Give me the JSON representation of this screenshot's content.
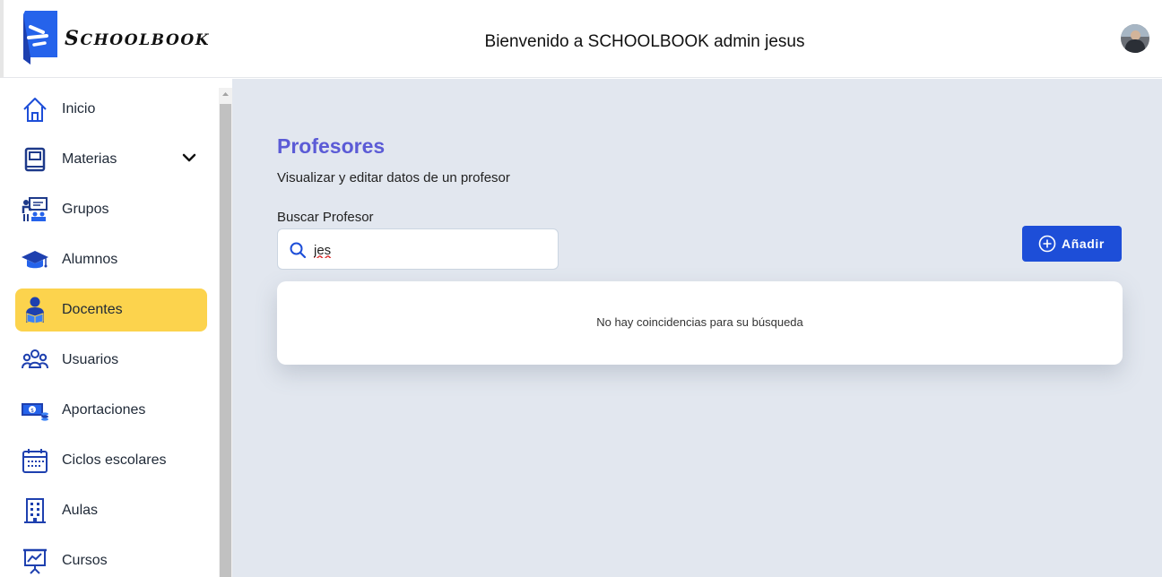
{
  "header": {
    "logo_text_first": "S",
    "logo_text_rest": "CHOOLBOOK",
    "welcome": "Bienvenido a SCHOOLBOOK admin jesus",
    "colors": {
      "logo_blue": "#2563eb"
    }
  },
  "sidebar": {
    "items": [
      {
        "label": "Inicio",
        "icon": "home-icon"
      },
      {
        "label": "Materias",
        "icon": "book-icon",
        "expandable": true
      },
      {
        "label": "Grupos",
        "icon": "classroom-icon"
      },
      {
        "label": "Alumnos",
        "icon": "graduation-cap-icon"
      },
      {
        "label": "Docentes",
        "icon": "teacher-icon",
        "active": true
      },
      {
        "label": "Usuarios",
        "icon": "users-icon"
      },
      {
        "label": "Aportaciones",
        "icon": "money-icon"
      },
      {
        "label": "Ciclos escolares",
        "icon": "calendar-icon"
      },
      {
        "label": "Aulas",
        "icon": "building-icon"
      },
      {
        "label": "Cursos",
        "icon": "presentation-icon"
      }
    ],
    "colors": {
      "active_bg": "#fcd34d",
      "icon": "#1d4ed8"
    }
  },
  "main": {
    "title": "Profesores",
    "subtitle": "Visualizar y editar datos de un profesor",
    "search": {
      "label": "Buscar Profesor",
      "value": "jes"
    },
    "add_button": "Añadir",
    "empty_message": "No hay coincidencias para su búsqueda",
    "colors": {
      "title": "#5b5bd6",
      "button": "#1d4ed8",
      "background": "#e2e7ef"
    }
  }
}
